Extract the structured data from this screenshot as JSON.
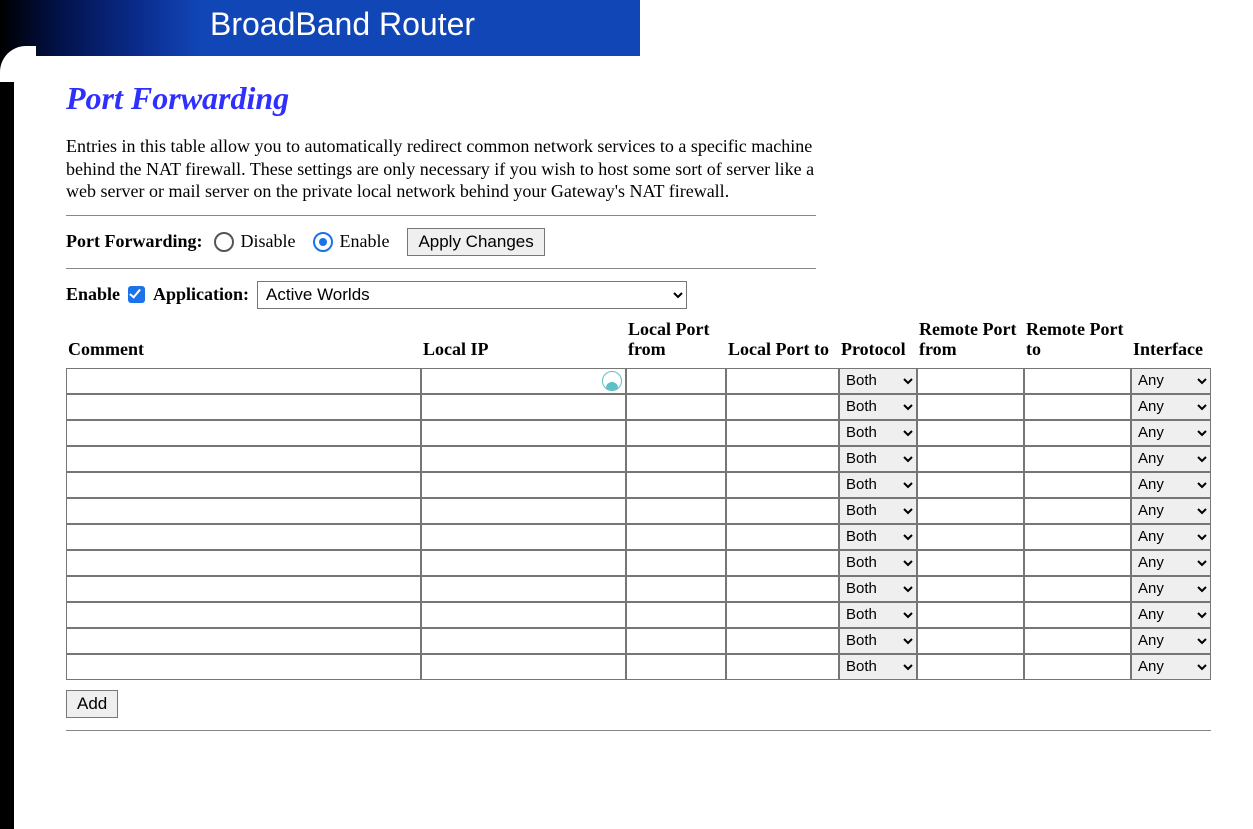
{
  "header": {
    "brand": "BroadBand Router"
  },
  "page": {
    "title": "Port Forwarding",
    "intro": "Entries in this table allow you to automatically redirect common network services to a specific machine behind the NAT firewall. These settings are only necessary if you wish to host some sort of server like a web server or mail server on the private local network behind your Gateway's NAT firewall."
  },
  "controls": {
    "pf_label": "Port Forwarding:",
    "disable_label": "Disable",
    "enable_label": "Enable",
    "pf_state": "Enable",
    "apply_label": "Apply Changes",
    "enable_row_label": "Enable",
    "enable_checked": true,
    "application_label": "Application:",
    "application_selected": "Active Worlds",
    "add_label": "Add"
  },
  "table": {
    "headers": {
      "comment": "Comment",
      "local_ip": "Local IP",
      "local_port_from": "Local Port from",
      "local_port_to": "Local Port to",
      "protocol": "Protocol",
      "remote_port_from": "Remote Port from",
      "remote_port_to": "Remote Port to",
      "interface": "Interface"
    },
    "protocol_default": "Both",
    "interface_default": "Any",
    "row_count": 12,
    "rows": [
      {
        "comment": "",
        "local_ip": "",
        "lp_from": "",
        "lp_to": "",
        "protocol": "Both",
        "rp_from": "",
        "rp_to": "",
        "interface": "Any",
        "vpn_badge": true
      },
      {
        "comment": "",
        "local_ip": "",
        "lp_from": "",
        "lp_to": "",
        "protocol": "Both",
        "rp_from": "",
        "rp_to": "",
        "interface": "Any"
      },
      {
        "comment": "",
        "local_ip": "",
        "lp_from": "",
        "lp_to": "",
        "protocol": "Both",
        "rp_from": "",
        "rp_to": "",
        "interface": "Any"
      },
      {
        "comment": "",
        "local_ip": "",
        "lp_from": "",
        "lp_to": "",
        "protocol": "Both",
        "rp_from": "",
        "rp_to": "",
        "interface": "Any"
      },
      {
        "comment": "",
        "local_ip": "",
        "lp_from": "",
        "lp_to": "",
        "protocol": "Both",
        "rp_from": "",
        "rp_to": "",
        "interface": "Any"
      },
      {
        "comment": "",
        "local_ip": "",
        "lp_from": "",
        "lp_to": "",
        "protocol": "Both",
        "rp_from": "",
        "rp_to": "",
        "interface": "Any"
      },
      {
        "comment": "",
        "local_ip": "",
        "lp_from": "",
        "lp_to": "",
        "protocol": "Both",
        "rp_from": "",
        "rp_to": "",
        "interface": "Any"
      },
      {
        "comment": "",
        "local_ip": "",
        "lp_from": "",
        "lp_to": "",
        "protocol": "Both",
        "rp_from": "",
        "rp_to": "",
        "interface": "Any"
      },
      {
        "comment": "",
        "local_ip": "",
        "lp_from": "",
        "lp_to": "",
        "protocol": "Both",
        "rp_from": "",
        "rp_to": "",
        "interface": "Any"
      },
      {
        "comment": "",
        "local_ip": "",
        "lp_from": "",
        "lp_to": "",
        "protocol": "Both",
        "rp_from": "",
        "rp_to": "",
        "interface": "Any"
      },
      {
        "comment": "",
        "local_ip": "",
        "lp_from": "",
        "lp_to": "",
        "protocol": "Both",
        "rp_from": "",
        "rp_to": "",
        "interface": "Any"
      },
      {
        "comment": "",
        "local_ip": "",
        "lp_from": "",
        "lp_to": "",
        "protocol": "Both",
        "rp_from": "",
        "rp_to": "",
        "interface": "Any"
      }
    ]
  }
}
